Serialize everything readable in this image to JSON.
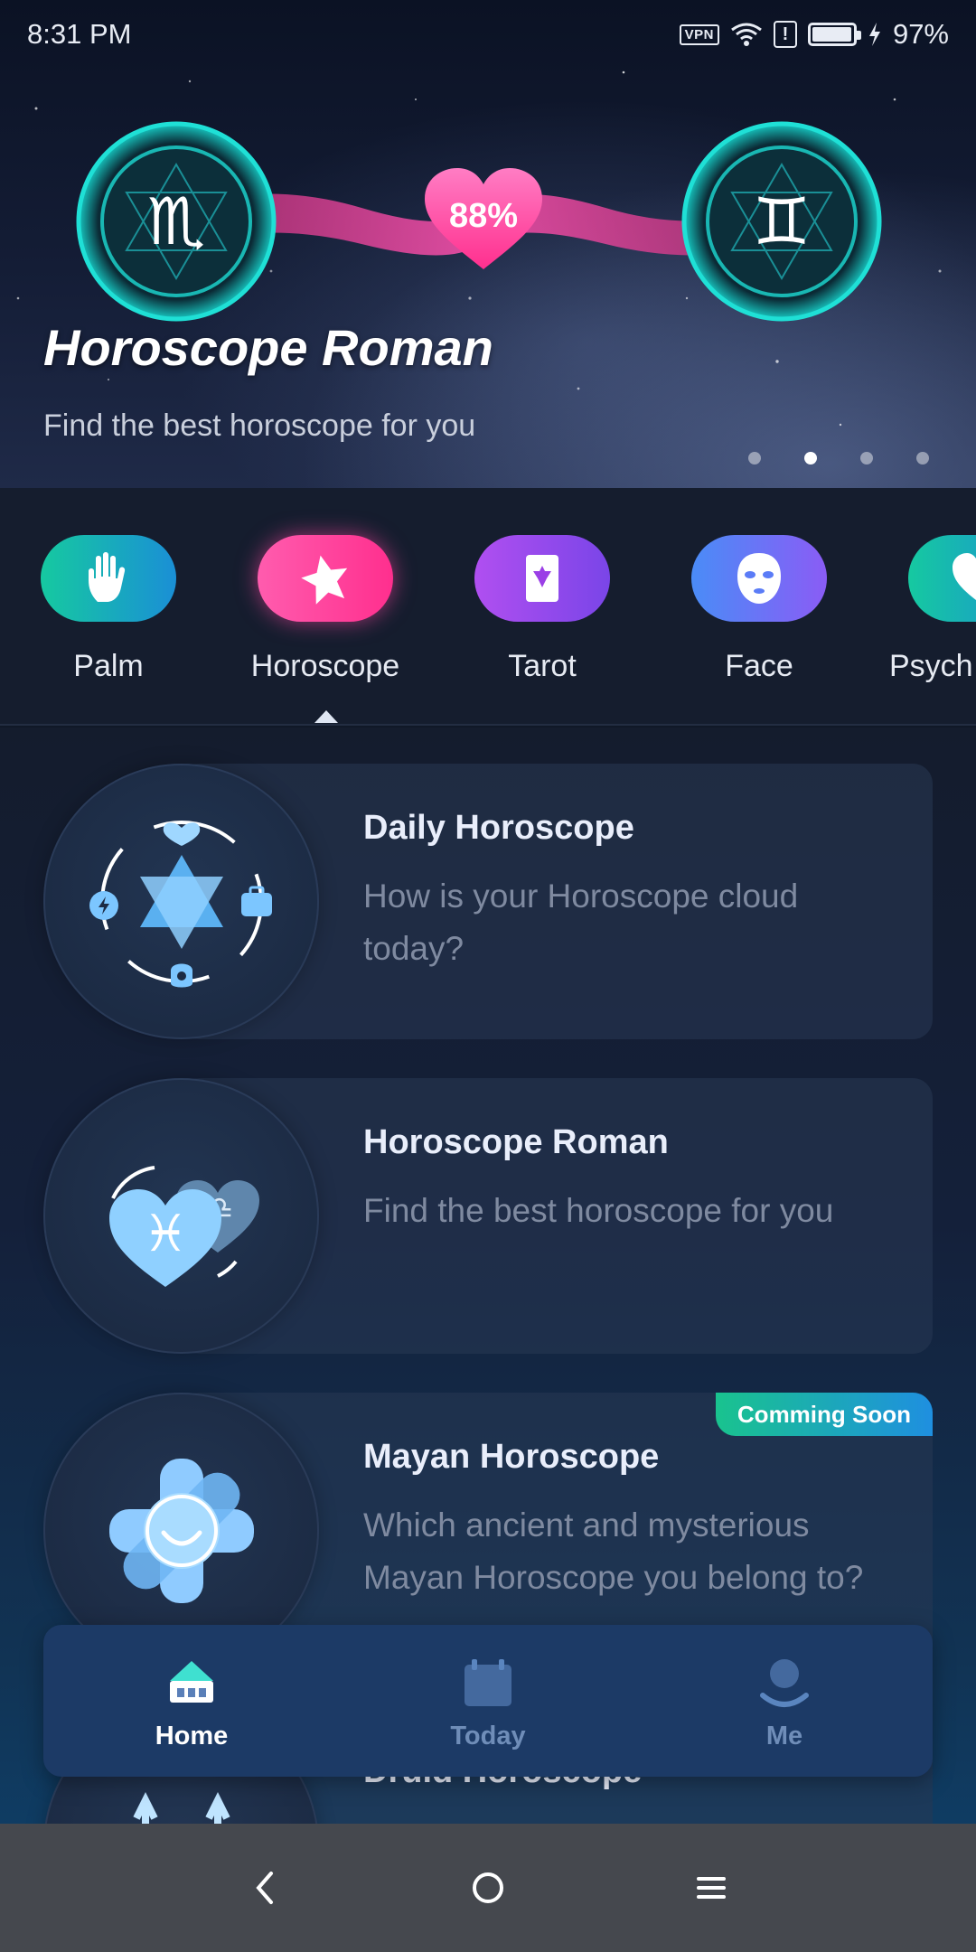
{
  "status_bar": {
    "time": "8:31 PM",
    "vpn": "VPN",
    "alert": "!",
    "battery_percent": "97%",
    "battery_level": 0.97
  },
  "hero": {
    "match_percent": "88%",
    "title": "Horoscope Roman",
    "subtitle": "Find the best horoscope for you",
    "carousel_pages": 4,
    "carousel_active_index": 1,
    "left_sign_icon": "scorpio-icon",
    "right_sign_icon": "gemini-icon"
  },
  "categories": [
    {
      "label": "Palm",
      "icon": "hand-icon",
      "color": "#17c2a4"
    },
    {
      "label": "Horoscope",
      "icon": "star-icon",
      "color": "#ff4fa3",
      "selected": true
    },
    {
      "label": "Tarot",
      "icon": "tarot-card-icon",
      "color": "#a44cf0"
    },
    {
      "label": "Face",
      "icon": "mask-face-icon",
      "color": "#5b7cf7"
    },
    {
      "label": "Psych",
      "icon": "heart-icon",
      "color": "#17c2a4"
    }
  ],
  "cards": [
    {
      "title": "Daily Horoscope",
      "desc": "How is your Horoscope cloud today?",
      "icon": "hexagram-icon"
    },
    {
      "title": "Horoscope Roman",
      "desc": "Find the best horoscope for you",
      "icon": "pisces-heart-icon"
    },
    {
      "title": "Mayan Horoscope",
      "desc": "Which ancient and mysterious Mayan Horoscope you belong to?",
      "icon": "mayan-sun-icon",
      "badge": "Comming Soon"
    },
    {
      "title": "Druid Horoscope",
      "desc": "",
      "icon": "druid-icon"
    }
  ],
  "bottom_nav": [
    {
      "label": "Home",
      "icon": "home-icon",
      "active": true
    },
    {
      "label": "Today",
      "icon": "calendar-icon",
      "active": false
    },
    {
      "label": "Me",
      "icon": "profile-icon",
      "active": false
    }
  ],
  "colors": {
    "accent_pink": "#ff4fa3",
    "accent_teal": "#17c2a4",
    "nav_bg": "#1c3a66"
  }
}
